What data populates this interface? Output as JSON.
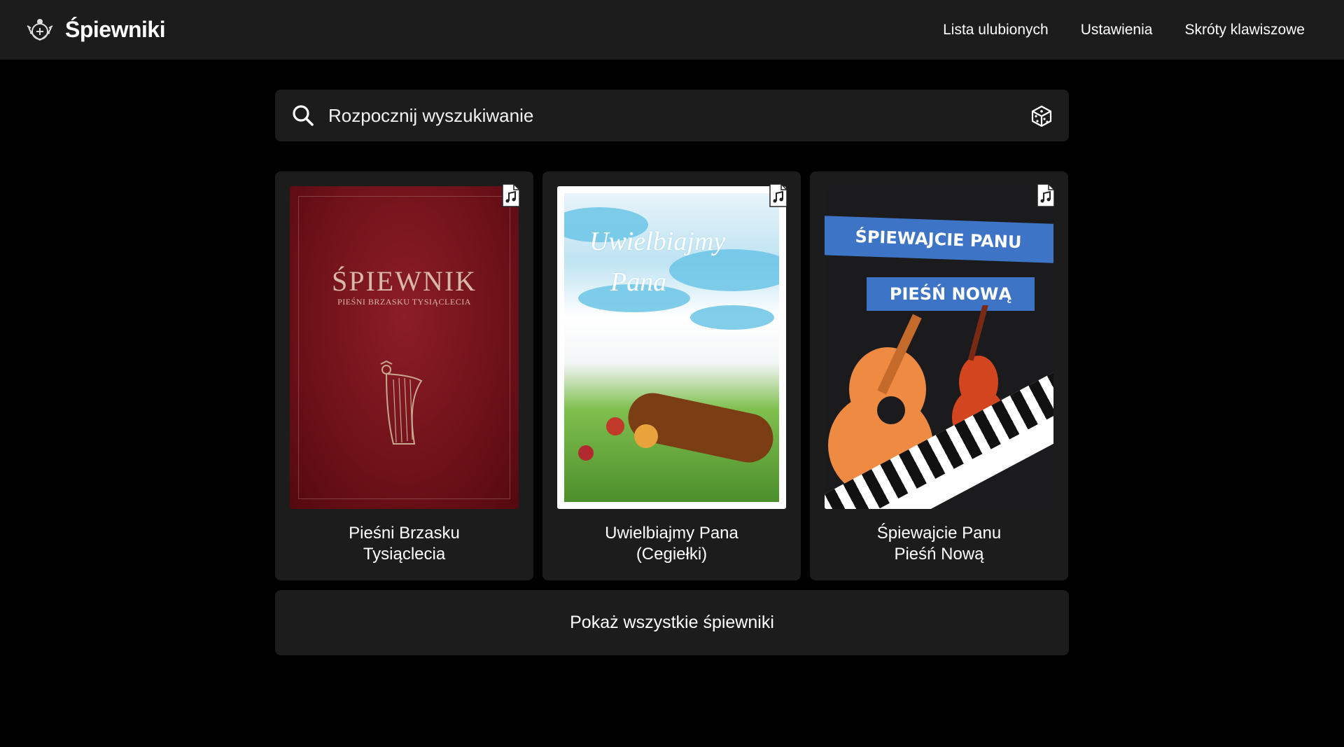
{
  "header": {
    "brand": "Śpiewniki",
    "nav": [
      {
        "label": "Lista ulubionych"
      },
      {
        "label": "Ustawienia"
      },
      {
        "label": "Skróty klawiszowe"
      }
    ]
  },
  "search": {
    "placeholder": "Rozpocznij wyszukiwanie"
  },
  "songbooks": [
    {
      "title_line1": "Pieśni Brzasku",
      "title_line2": "Tysiąclecia",
      "cover_title": "ŚPIEWNIK",
      "cover_subtitle": "PIEŚNI BRZASKU TYSIĄCLECIA"
    },
    {
      "title_line1": "Uwielbiajmy Pana",
      "title_line2": "(Cegiełki)",
      "cover_script_line1": "Uwielbiajmy",
      "cover_script_line2": "Pana"
    },
    {
      "title_line1": "Śpiewajcie Panu",
      "title_line2": "Pieśń Nową",
      "cover_ribbon1": "ŚPIEWAJCIE PANU",
      "cover_ribbon2": "PIEŚŃ NOWĄ"
    }
  ],
  "show_all": "Pokaż wszystkie śpiewniki",
  "icons": {
    "logo": "emblem-logo",
    "search": "search-icon",
    "random": "dice-icon",
    "music_file": "music-file-icon"
  },
  "colors": {
    "background": "#000000",
    "surface": "#1c1c1c",
    "text": "#ffffff"
  }
}
